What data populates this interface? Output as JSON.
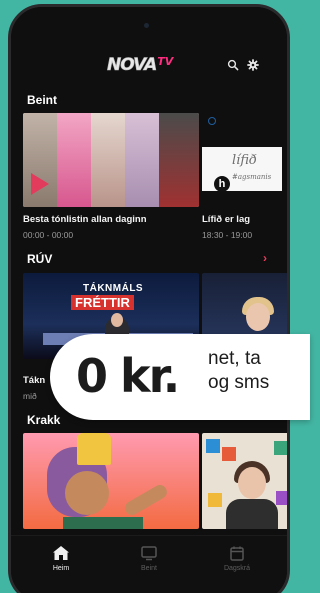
{
  "app": {
    "logo_main": "NOVA",
    "logo_tv": "TV"
  },
  "header": {
    "icons": [
      "search-icon",
      "gear-icon"
    ]
  },
  "sections": [
    {
      "title": "Beint",
      "cards": [
        {
          "title": "Besta tónlistin allan daginn",
          "time": "00:00 - 00:00"
        },
        {
          "title": "Lífið er lag",
          "time": "18:30 - 19:00",
          "thumb_script": "lífið",
          "thumb_sub": "#agsmanis",
          "thumb_badge": "h"
        }
      ]
    },
    {
      "title": "RÚV",
      "has_chevron": true,
      "cards": [
        {
          "title": "Tákn",
          "time": "mið",
          "thumb_line1": "TÁKNMÁLS",
          "thumb_line2": "FRÉTTIR"
        },
        {
          "title": "",
          "time": ""
        }
      ]
    },
    {
      "title": "Krakk",
      "cards": [
        {
          "title": "",
          "time": ""
        },
        {
          "title": "",
          "time": ""
        }
      ]
    }
  ],
  "promo": {
    "price": "0 kr.",
    "line1": "net, ta",
    "line2": "og sms"
  },
  "tabbar": {
    "tabs": [
      {
        "label": "Heim",
        "icon": "home-icon",
        "active": true
      },
      {
        "label": "Beint",
        "icon": "tv-icon",
        "active": false
      },
      {
        "label": "Dagskrá",
        "icon": "calendar-icon",
        "active": false
      }
    ]
  },
  "colors": {
    "background": "#43b6a3",
    "screen": "#0f0f10",
    "accent": "#e83e5b",
    "logo_tv": "#ff2e7e"
  }
}
